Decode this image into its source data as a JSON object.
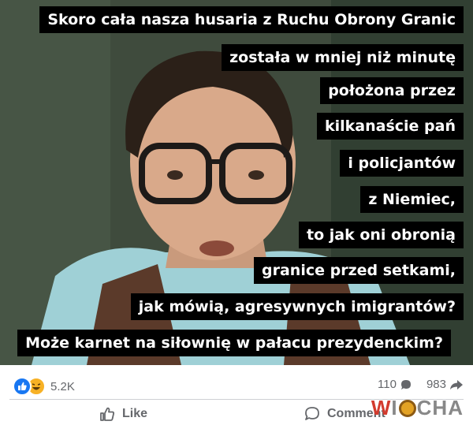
{
  "post": {
    "caption_lines": [
      "Skoro cała nasza husaria z Ruchu Obrony Granic",
      "została w mniej niż minutę",
      "położona przez",
      "kilkanaście pań",
      "i policjantów",
      "z Niemiec,",
      "to jak oni obronią",
      "granice przed setkami,",
      "jak mówią, agresywnych imigrantów?",
      "Może karnet na siłownię w pałacu prezydenckim?"
    ]
  },
  "reactions": {
    "icons": [
      "like-icon",
      "haha-icon"
    ],
    "count": "5.2K"
  },
  "stats": {
    "comments": "110",
    "shares": "983"
  },
  "actions": {
    "like_label": "Like",
    "comment_label": "Comment"
  },
  "watermark": {
    "text_start": "W",
    "text_mid": "I",
    "text_end": "CHA"
  },
  "colors": {
    "like_blue": "#1877f2",
    "haha_yellow": "#f7b125",
    "meta_gray": "#65676b",
    "caption_bg": "#000000",
    "caption_text": "#ffffff"
  }
}
